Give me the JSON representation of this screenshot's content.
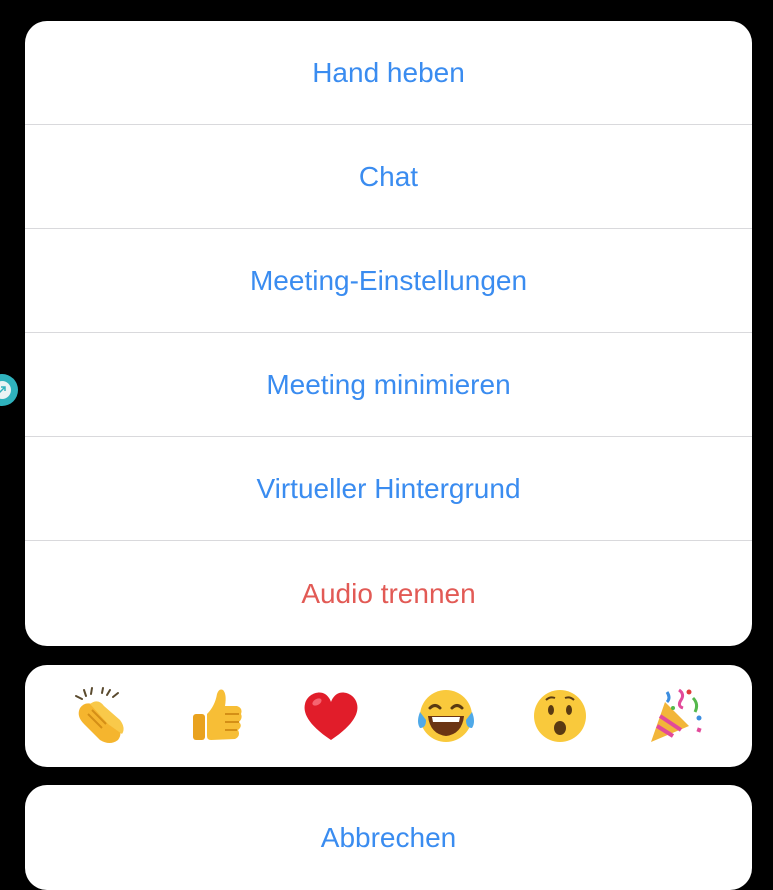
{
  "menu": {
    "items": [
      {
        "label": "Hand heben"
      },
      {
        "label": "Chat"
      },
      {
        "label": "Meeting-Einstellungen"
      },
      {
        "label": "Meeting minimieren"
      },
      {
        "label": "Virtueller Hintergrund"
      },
      {
        "label": "Audio trennen",
        "destructive": true
      }
    ]
  },
  "reactions": [
    {
      "icon": "clapping-hands-icon"
    },
    {
      "icon": "thumbs-up-icon"
    },
    {
      "icon": "red-heart-icon"
    },
    {
      "icon": "tears-of-joy-icon"
    },
    {
      "icon": "surprised-face-icon"
    },
    {
      "icon": "party-popper-icon"
    }
  ],
  "cancel": {
    "label": "Abbrechen"
  },
  "colors": {
    "action_blue": "#3a8cf0",
    "destructive_red": "#e25a55",
    "background": "#000000",
    "sheet": "#ffffff",
    "handle_teal": "#2fb2bd"
  }
}
